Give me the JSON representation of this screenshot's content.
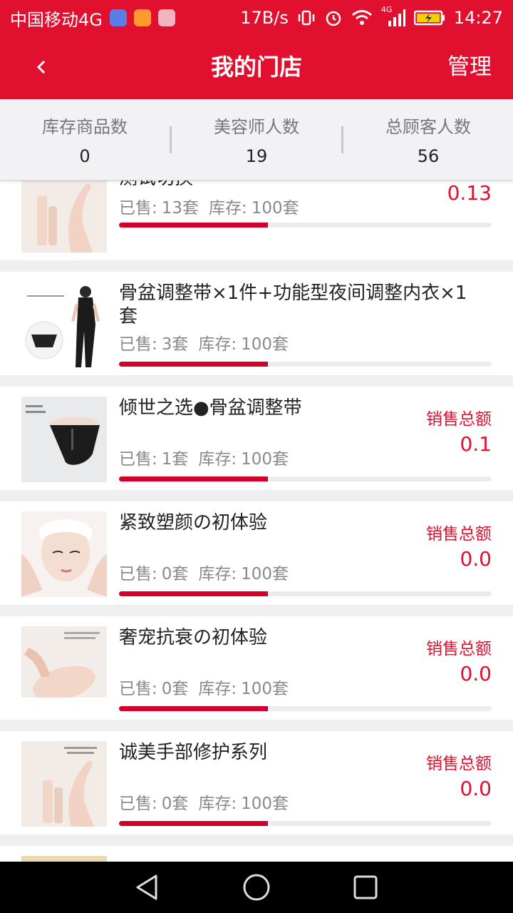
{
  "status_bar": {
    "carrier": "中国移动4G",
    "speed": "17B/s",
    "signal_tag": "4G",
    "time": "14:27"
  },
  "header": {
    "back_icon": "chevron-left-icon",
    "title": "我的门店",
    "manage_label": "管理"
  },
  "stats": [
    {
      "label": "库存商品数",
      "value": "0"
    },
    {
      "label": "美容师人数",
      "value": "19"
    },
    {
      "label": "总顾客人数",
      "value": "56"
    }
  ],
  "labels": {
    "sold": "已售:",
    "stock": "库存:",
    "sales_total": "销售总额"
  },
  "products": [
    {
      "name": "测试切换",
      "sold": "13套",
      "stock": "100套",
      "sales": "0.13",
      "progress": 0.4
    },
    {
      "name": "骨盆调整带×1件+功能型夜间调整内衣×1套",
      "sold": "3套",
      "stock": "100套",
      "sales": "",
      "progress": 0.4
    },
    {
      "name": "倾世之选●骨盆调整带",
      "sold": "1套",
      "stock": "100套",
      "sales": "0.1",
      "progress": 0.4
    },
    {
      "name": "紧致塑颜の初体验",
      "sold": "0套",
      "stock": "100套",
      "sales": "0.0",
      "progress": 0.4
    },
    {
      "name": "奢宠抗衰の初体验",
      "sold": "0套",
      "stock": "100套",
      "sales": "0.0",
      "progress": 0.4
    },
    {
      "name": "诚美手部修护系列",
      "sold": "0套",
      "stock": "100套",
      "sales": "0.0",
      "progress": 0.4
    }
  ],
  "colors": {
    "accent": "#e0102e",
    "progress_fill": "#d3002c"
  }
}
